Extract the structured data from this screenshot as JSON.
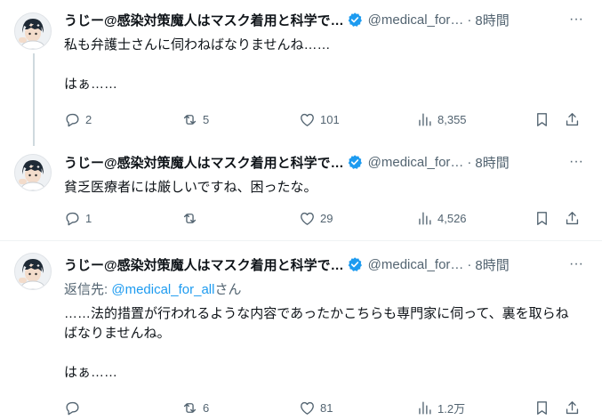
{
  "tweets": [
    {
      "name": "うじー@感染対策魔人はマスク着用と科学で…",
      "handle": "@medical_for…",
      "time": "8時間",
      "reply_prefix": "",
      "reply_mention": "",
      "reply_suffix": "",
      "text": "私も弁護士さんに伺わねばなりませんね……\n\nはぁ……",
      "replies": "2",
      "retweets": "5",
      "likes": "101",
      "views": "8,355"
    },
    {
      "name": "うじー@感染対策魔人はマスク着用と科学で…",
      "handle": "@medical_for…",
      "time": "8時間",
      "reply_prefix": "",
      "reply_mention": "",
      "reply_suffix": "",
      "text": "貧乏医療者には厳しいですね、困ったな。",
      "replies": "1",
      "retweets": "",
      "likes": "29",
      "views": "4,526"
    },
    {
      "name": "うじー@感染対策魔人はマスク着用と科学で…",
      "handle": "@medical_for…",
      "time": "8時間",
      "reply_prefix": "返信先: ",
      "reply_mention": "@medical_for_all",
      "reply_suffix": "さん",
      "text": "……法的措置が行われるような内容であったかこちらも専門家に伺って、裏を取らねばなりませんね。\n\nはぁ……",
      "replies": "",
      "retweets": "6",
      "likes": "81",
      "views": "1.2万"
    }
  ],
  "time_separator": "·",
  "more_glyph": "···",
  "icons": {
    "verified": "verified-badge-icon",
    "reply": "reply-icon",
    "retweet": "retweet-icon",
    "like": "heart-icon",
    "views": "views-icon",
    "bookmark": "bookmark-icon",
    "share": "share-icon"
  },
  "colors": {
    "verified": "#1d9bf0",
    "secondary_text": "#536471",
    "mention": "#1d9bf0",
    "thread_line": "#cfd9de"
  }
}
